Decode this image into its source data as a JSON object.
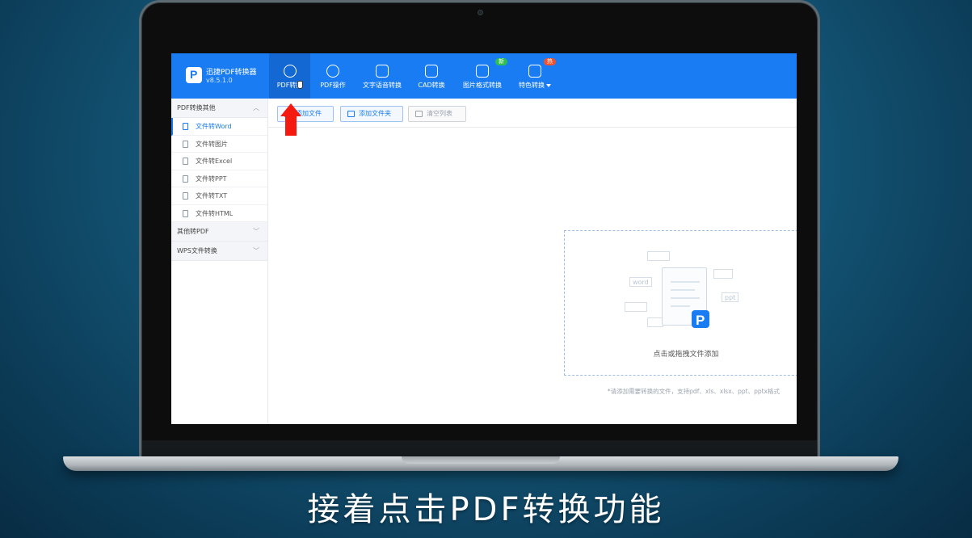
{
  "app": {
    "name": "迅捷PDF转换器",
    "version": "v8.5.1.0"
  },
  "nav": [
    {
      "label": "PDF转换",
      "icon": "pdf-convert-icon",
      "active": true
    },
    {
      "label": "PDF操作",
      "icon": "pdf-operate-icon"
    },
    {
      "label": "文字语音转换",
      "icon": "voice-wave-icon"
    },
    {
      "label": "CAD转换",
      "icon": "cad-icon"
    },
    {
      "label": "图片格式转换",
      "icon": "image-icon",
      "badge": "新"
    },
    {
      "label": "特色转换",
      "icon": "special-icon",
      "badge": "热"
    }
  ],
  "sidebar": {
    "groups": [
      {
        "label": "PDF转换其他",
        "expanded": true,
        "items": [
          {
            "label": "文件转Word",
            "active": true
          },
          {
            "label": "文件转图片"
          },
          {
            "label": "文件转Excel"
          },
          {
            "label": "文件转PPT"
          },
          {
            "label": "文件转TXT"
          },
          {
            "label": "文件转HTML"
          }
        ]
      },
      {
        "label": "其他转PDF",
        "expanded": false
      },
      {
        "label": "WPS文件转换",
        "expanded": false
      }
    ]
  },
  "toolbar": {
    "add_file": "添加文件",
    "add_folder": "添加文件夹",
    "clear_list": "清空列表"
  },
  "dropzone": {
    "text": "点击或拖拽文件添加",
    "formats": [
      "word",
      "ppt"
    ]
  },
  "note": "*请添加需要转换的文件，支持pdf、xls、xlsx、ppt、pptx格式",
  "caption": "接着点击PDF转换功能",
  "colors": {
    "brand": "#1a7cf2",
    "annotation": "#f41a10",
    "new_badge": "#2fbf4f",
    "hot_badge": "#f0522d"
  }
}
